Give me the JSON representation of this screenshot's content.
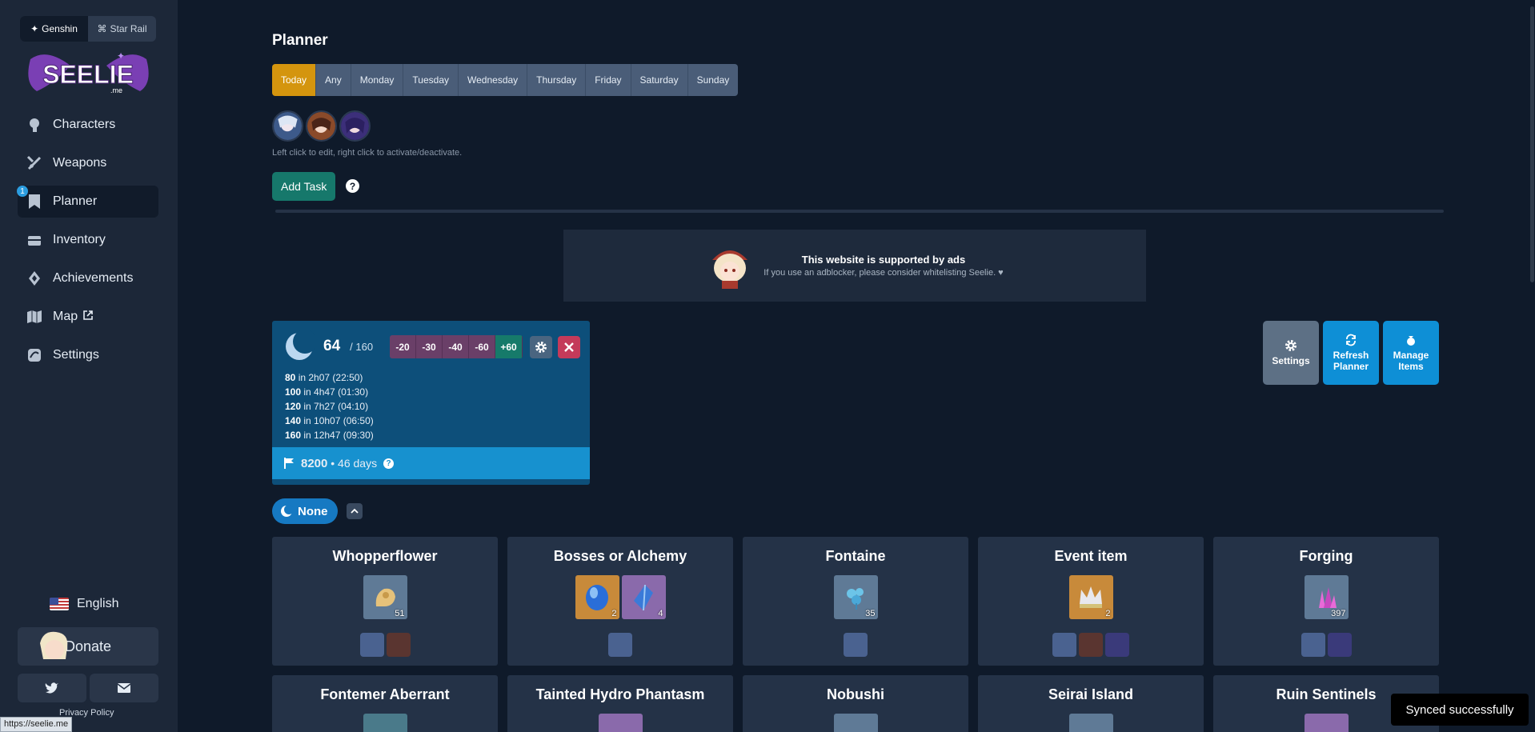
{
  "sidebar": {
    "games": [
      {
        "label": "Genshin"
      },
      {
        "label": "Star Rail"
      }
    ],
    "logo_text": "SEELIE",
    "logo_sub": ".me",
    "nav": [
      {
        "label": "Characters",
        "icon": "character-icon"
      },
      {
        "label": "Weapons",
        "icon": "weapon-icon"
      },
      {
        "label": "Planner",
        "icon": "bookmark-icon",
        "badge": "1"
      },
      {
        "label": "Inventory",
        "icon": "chest-icon"
      },
      {
        "label": "Achievements",
        "icon": "achievement-icon"
      },
      {
        "label": "Map",
        "icon": "map-icon"
      },
      {
        "label": "Settings",
        "icon": "settings-icon"
      }
    ],
    "language": "English",
    "donate_label": "Donate",
    "privacy": "Privacy Policy",
    "status_url": "https://seelie.me"
  },
  "planner": {
    "title": "Planner",
    "days": [
      "Today",
      "Any",
      "Monday",
      "Tuesday",
      "Wednesday",
      "Thursday",
      "Friday",
      "Saturday",
      "Sunday"
    ],
    "hint": "Left click to edit, right click to activate/deactivate.",
    "add_task": "Add Task",
    "help": "?"
  },
  "ad": {
    "title": "This website is supported by ads",
    "subtitle": "If you use an adblocker, please consider whitelisting Seelie. ♥"
  },
  "resin": {
    "current": "64",
    "max": "/ 160",
    "buttons": [
      "-20",
      "-30",
      "-40",
      "-60",
      "+60"
    ],
    "schedule": [
      {
        "amount": "80",
        "text": " in 2h07 (22:50)"
      },
      {
        "amount": "100",
        "text": " in 4h47 (01:30)"
      },
      {
        "amount": "120",
        "text": " in 7h27 (04:10)"
      },
      {
        "amount": "140",
        "text": " in 10h07 (06:50)"
      },
      {
        "amount": "160",
        "text": " in 12h47 (09:30)"
      }
    ],
    "goal_value": "8200",
    "goal_days": " • 46 days"
  },
  "actions": {
    "settings": "Settings",
    "refresh": "Refresh Planner",
    "manage": "Manage Items"
  },
  "filter": {
    "label": "None"
  },
  "cards": [
    {
      "title": "Whopperflower",
      "items": [
        {
          "color": "blue",
          "count": "51"
        }
      ],
      "chars": [
        "f"
      ]
    },
    {
      "title": "Bosses or Alchemy",
      "items": [
        {
          "color": "gold",
          "count": "2"
        },
        {
          "color": "purple",
          "count": "4"
        }
      ],
      "chars": [
        "f"
      ]
    },
    {
      "title": "Fontaine",
      "items": [
        {
          "color": "blue",
          "count": "35"
        }
      ],
      "chars": [
        "f"
      ]
    },
    {
      "title": "Event item",
      "items": [
        {
          "color": "gold",
          "count": "2"
        }
      ],
      "chars": [
        "f"
      ]
    },
    {
      "title": "Forging",
      "items": [
        {
          "color": "blue",
          "count": "397"
        }
      ],
      "chars": [
        "f"
      ]
    }
  ],
  "cards_row2": [
    "Fontemer Aberrant",
    "Tainted Hydro Phantasm",
    "Nobushi",
    "Seirai Island",
    "Ruin Sentinels"
  ],
  "toast": "Synced successfully"
}
